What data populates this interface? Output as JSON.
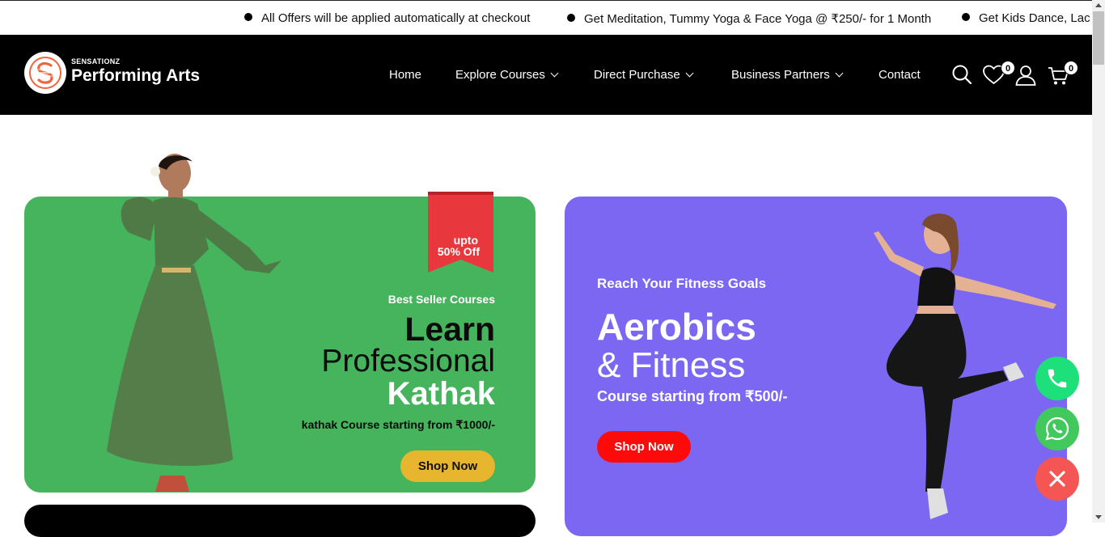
{
  "ticker": {
    "items": [
      "All Offers will be applied automatically at checkout",
      "Get Meditation, Tummy Yoga & Face Yoga @ ₹250/- for 1 Month",
      "Get Kids Dance, Lac"
    ]
  },
  "brand": {
    "small": "SENSATIONZ",
    "name": "Performing Arts"
  },
  "nav": {
    "items": [
      {
        "label": "Home"
      },
      {
        "label": "Explore Courses"
      },
      {
        "label": "Direct Purchase"
      },
      {
        "label": "Business Partners"
      },
      {
        "label": "Contact"
      }
    ],
    "wishlist_count": "0",
    "cart_count": "0"
  },
  "card_kathak": {
    "ribbon": "upto\n50% Off",
    "ribbon_line1": "upto",
    "ribbon_line2": "50% Off",
    "tag": "Best Seller Courses",
    "line1": "Learn",
    "line2": "Professional",
    "line3": "Kathak",
    "subtitle": "kathak Course starting from ₹1000/-",
    "button": "Shop Now"
  },
  "card_aerobics": {
    "tag": "Reach Your Fitness Goals",
    "line1": "Aerobics",
    "line2": "& Fitness",
    "subtitle": "Course starting from ₹500/-",
    "button": "Shop Now"
  },
  "colors": {
    "green_card": "#45b45c",
    "purple_card": "#7b67f2",
    "ribbon": "#e8373d",
    "kathak_button": "#e7b52e",
    "aerobics_button": "#ff0a0a",
    "phone": "#1de07a",
    "whatsapp": "#42c95e",
    "close": "#f55553"
  }
}
